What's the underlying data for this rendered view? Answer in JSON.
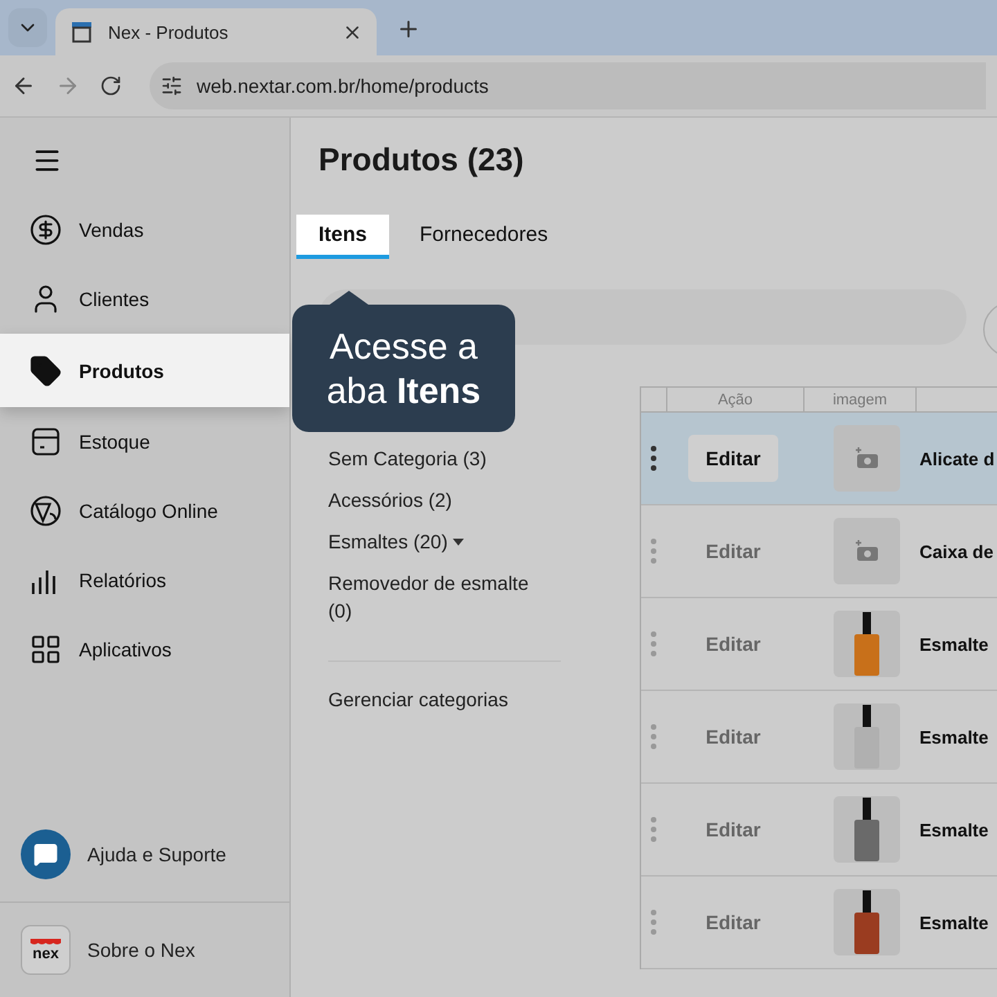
{
  "browser": {
    "tab_title": "Nex - Produtos",
    "url": "web.nextar.com.br/home/products"
  },
  "sidebar": {
    "items": [
      {
        "kind": "sales",
        "label": "Vendas",
        "selected": false
      },
      {
        "kind": "clients",
        "label": "Clientes",
        "selected": false
      },
      {
        "kind": "products",
        "label": "Produtos",
        "selected": true
      },
      {
        "kind": "stock",
        "label": "Estoque",
        "selected": false
      },
      {
        "kind": "catalog",
        "label": "Catálogo Online",
        "selected": false
      },
      {
        "kind": "reports",
        "label": "Relatórios",
        "selected": false
      },
      {
        "kind": "apps",
        "label": "Aplicativos",
        "selected": false
      }
    ],
    "help": "Ajuda e Suporte",
    "about": "Sobre o Nex",
    "logo": "nex"
  },
  "page": {
    "title": "Produtos (23)",
    "tabs": [
      {
        "label": "Itens",
        "selected": true
      },
      {
        "label": "Fornecedores",
        "selected": false
      }
    ],
    "tooltip": "Acesse a aba **Itens**",
    "categories": [
      {
        "label": "Sem Categoria (3)",
        "expandable": false
      },
      {
        "label": "Acessórios (2)",
        "expandable": false
      },
      {
        "label": "Esmaltes (20)",
        "expandable": true
      },
      {
        "label": "Removedor de esmalte (0)",
        "expandable": false
      }
    ],
    "manage_categories": "Gerenciar categorias",
    "table": {
      "columns": [
        "Ação",
        "imagem"
      ],
      "rows": [
        {
          "kind": "placeholder",
          "action": "Editar",
          "name": "Alicate d",
          "selected": true
        },
        {
          "kind": "placeholder",
          "action": "Editar",
          "name": "Caixa de",
          "selected": false
        },
        {
          "kind": "photo",
          "action": "Editar",
          "color": "#c8701a",
          "name": "Esmalte",
          "selected": false
        },
        {
          "kind": "photo",
          "action": "Editar",
          "color": "#b0b0b0",
          "name": "Esmalte",
          "selected": false
        },
        {
          "kind": "photo",
          "action": "Editar",
          "color": "#6a6a6a",
          "name": "Esmalte",
          "selected": false
        },
        {
          "kind": "photo",
          "action": "Editar",
          "color": "#9a3c20",
          "name": "Esmalte",
          "selected": false
        }
      ]
    }
  }
}
